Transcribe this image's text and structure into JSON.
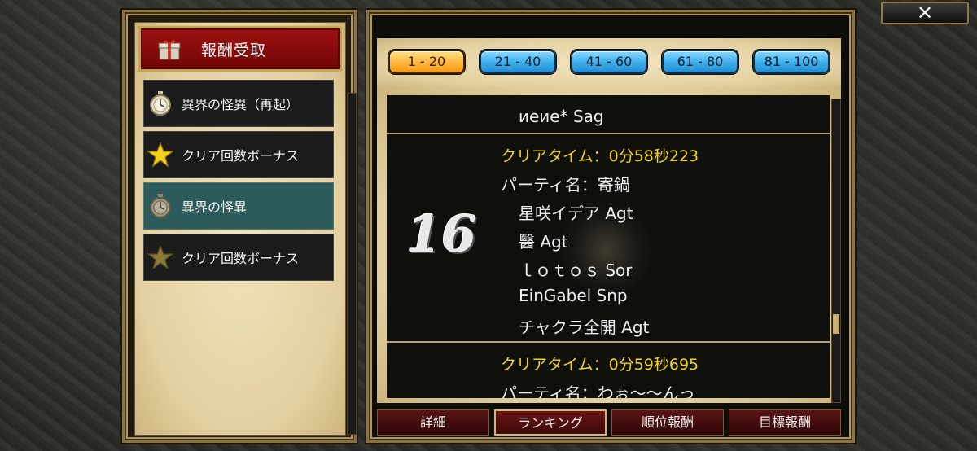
{
  "reward_button": {
    "label": "報酬受取",
    "icon": "gift-icon"
  },
  "sidebar": {
    "items": [
      {
        "label": "異界の怪異（再起）",
        "icon": "stopwatch-icon",
        "selected": false
      },
      {
        "label": "クリア回数ボーナス",
        "icon": "star-icon",
        "selected": false
      },
      {
        "label": "異界の怪異",
        "icon": "stopwatch-icon",
        "selected": true
      },
      {
        "label": "クリア回数ボーナス",
        "icon": "star-icon",
        "selected": false
      }
    ]
  },
  "range_tabs": [
    {
      "label": "1 - 20",
      "active": true
    },
    {
      "label": "21 - 40",
      "active": false
    },
    {
      "label": "41 - 60",
      "active": false
    },
    {
      "label": "61 - 80",
      "active": false
    },
    {
      "label": "81 - 100",
      "active": false
    }
  ],
  "ranking": {
    "prev_entry_last_member": "иеие* Sag",
    "entries": [
      {
        "rank": "16",
        "clear_time": "クリアタイム：0分58秒223",
        "party_name": "パーティ名：寄鍋",
        "members": [
          "星咲イデア Agt",
          "醫 Agt",
          "ｌｏｔｏｓ Sor",
          "EinGabel Snp",
          "チャクラ全開 Agt"
        ]
      },
      {
        "clear_time": "クリアタイム：0分59秒695",
        "party_name": "パーティ名：わぉ～～んっ"
      }
    ]
  },
  "bottom_tabs": [
    {
      "label": "詳細",
      "active": false
    },
    {
      "label": "ランキング",
      "active": true
    },
    {
      "label": "順位報酬",
      "active": false
    },
    {
      "label": "目標報酬",
      "active": false
    }
  ],
  "close_button": {
    "icon": "close-icon",
    "glyph": "✕"
  },
  "colors": {
    "time_text": "#f3d61b",
    "selected_item": "#2d5a5a",
    "active_tab": "#ffb53a",
    "tab": "#3fb1ee"
  }
}
